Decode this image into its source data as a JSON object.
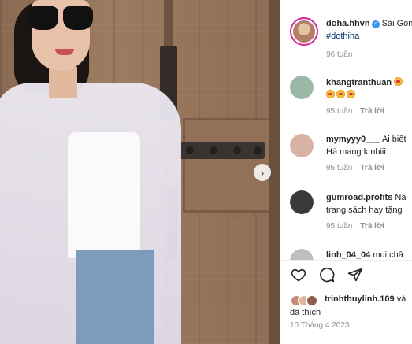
{
  "post": {
    "author": "doha.hhvn",
    "location": "Sài Gòn",
    "caption_tag": "#dothiha",
    "caption_time": "96 tuần",
    "date": "10 Tháng 4 2023",
    "likes_prefix": "trinhthuylinh.109",
    "likes_suffix": "và",
    "likes_second_line": "đã thích"
  },
  "comments": [
    {
      "username": "khangtranthuan",
      "line1": "",
      "line2": "",
      "time": "95 tuần",
      "reply": "Trả lời",
      "avatar_color": "#9bb7a6"
    },
    {
      "username": "mymyyy0___",
      "line1": "Ai biết",
      "line2": "Hà mang k nhiii",
      "time": "95 tuần",
      "reply": "Trả lời",
      "avatar_color": "#d8b3a3"
    },
    {
      "username": "gumroad.profits",
      "line1": "Na",
      "line2": "trang sách hay tặng",
      "time": "95 tuần",
      "reply": "Trả lời",
      "avatar_color": "#3a3a3a"
    },
    {
      "username": "linh_04_04",
      "line1": "mui châ",
      "line2": "",
      "time": "",
      "reply": "",
      "avatar_color": "#bfbfbf"
    }
  ],
  "icons": {
    "like": "heart-icon",
    "comment": "comment-icon",
    "share": "share-icon",
    "next": "chevron-right-icon",
    "verified": "verified-badge-icon"
  },
  "colors": {
    "text": "#262626",
    "muted": "#8e8e8e",
    "hashtag": "#00376b",
    "verified": "#3897f0"
  }
}
